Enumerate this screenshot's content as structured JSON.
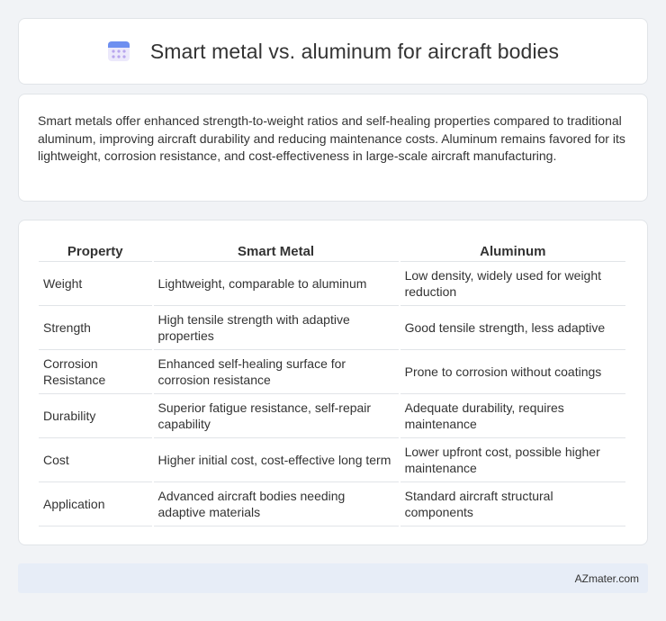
{
  "header": {
    "title": "Smart metal vs. aluminum for aircraft bodies",
    "icon": "calendar-icon",
    "icon_color": "#7c6fe0"
  },
  "summary": {
    "text": "Smart metals offer enhanced strength-to-weight ratios and self-healing properties compared to traditional aluminum, improving aircraft durability and reducing maintenance costs. Aluminum remains favored for its lightweight, corrosion resistance, and cost-effectiveness in large-scale aircraft manufacturing."
  },
  "table": {
    "headers": [
      "Property",
      "Smart Metal",
      "Aluminum"
    ],
    "rows": [
      [
        "Weight",
        "Lightweight, comparable to aluminum",
        "Low density, widely used for weight reduction"
      ],
      [
        "Strength",
        "High tensile strength with adaptive properties",
        "Good tensile strength, less adaptive"
      ],
      [
        "Corrosion Resistance",
        "Enhanced self-healing surface for corrosion resistance",
        "Prone to corrosion without coatings"
      ],
      [
        "Durability",
        "Superior fatigue resistance, self-repair capability",
        "Adequate durability, requires maintenance"
      ],
      [
        "Cost",
        "Higher initial cost, cost-effective long term",
        "Lower upfront cost, possible higher maintenance"
      ],
      [
        "Application",
        "Advanced aircraft bodies needing adaptive materials",
        "Standard aircraft structural components"
      ]
    ]
  },
  "footer": {
    "brand": "AZmater.com"
  }
}
